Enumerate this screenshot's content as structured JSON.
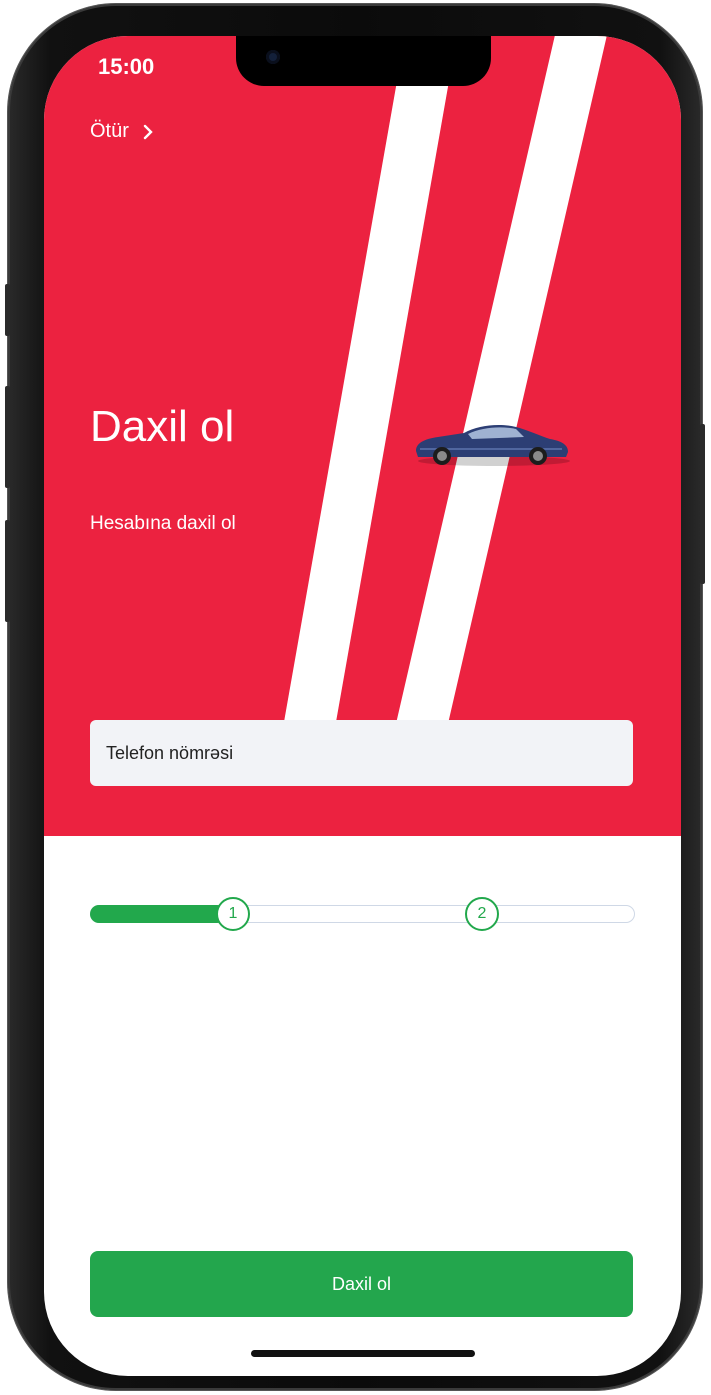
{
  "status_bar": {
    "time": "15:00"
  },
  "header": {
    "skip_label": "Ötür"
  },
  "hero": {
    "title": "Daxil ol",
    "subtitle": "Hesabına daxil ol",
    "background_color": "#EC2240",
    "image": "sports-car"
  },
  "steps": {
    "items": [
      {
        "label": "1"
      },
      {
        "label": "2"
      }
    ],
    "current": 1,
    "progress_fraction": 0.25,
    "accent_color": "#22A84C"
  },
  "form": {
    "phone_placeholder": "Telefon nömrəsi"
  },
  "actions": {
    "submit_label": "Daxil ol",
    "submit_color": "#23A64D"
  }
}
